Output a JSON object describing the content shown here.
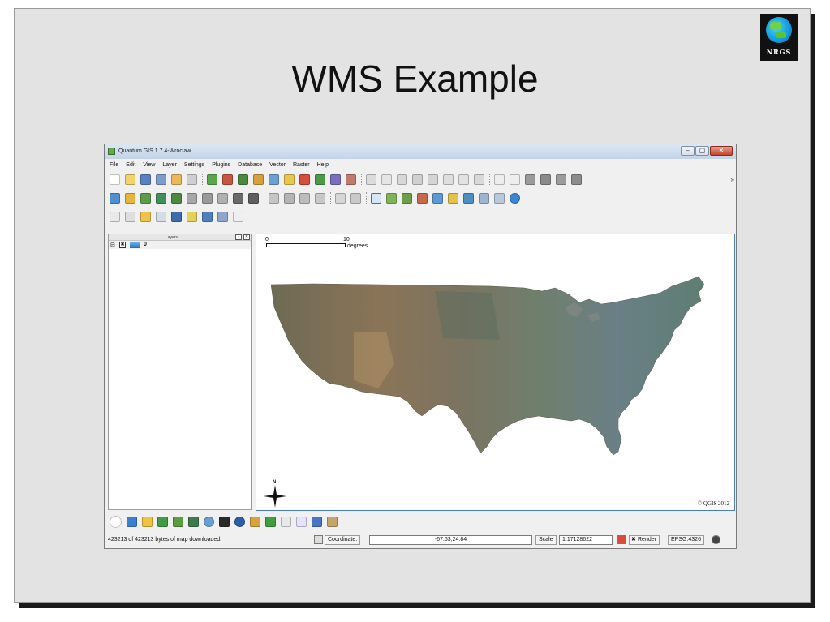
{
  "slide": {
    "title": "WMS Example",
    "logo_text": "NRGS"
  },
  "window": {
    "title": "Quantum GIS 1.7.4-Wroclaw",
    "controls": {
      "minimize": "–",
      "maximize": "▢",
      "close": "✕"
    }
  },
  "menu": [
    "File",
    "Edit",
    "View",
    "Layer",
    "Settings",
    "Plugins",
    "Database",
    "Vector",
    "Raster",
    "Help"
  ],
  "toolbars": {
    "more": "»"
  },
  "layers_panel": {
    "title": "Layers",
    "float_btn": "▫",
    "close_btn": "✕",
    "expand": "⊟",
    "layer_name": "0"
  },
  "map": {
    "scale_start": "0",
    "scale_end": "10",
    "scale_unit": "degrees",
    "north_label": "N",
    "copyright": "© QGIS 2012"
  },
  "status": {
    "message": "423213 of 423213 bytes of map downloaded.",
    "coordinate_label": "Coordinate:",
    "coordinate_value": "-67.63,24.84",
    "scale_label": "Scale",
    "scale_value": "1:17128622",
    "render_label": "Render",
    "epsg": "EPSG:4326"
  }
}
